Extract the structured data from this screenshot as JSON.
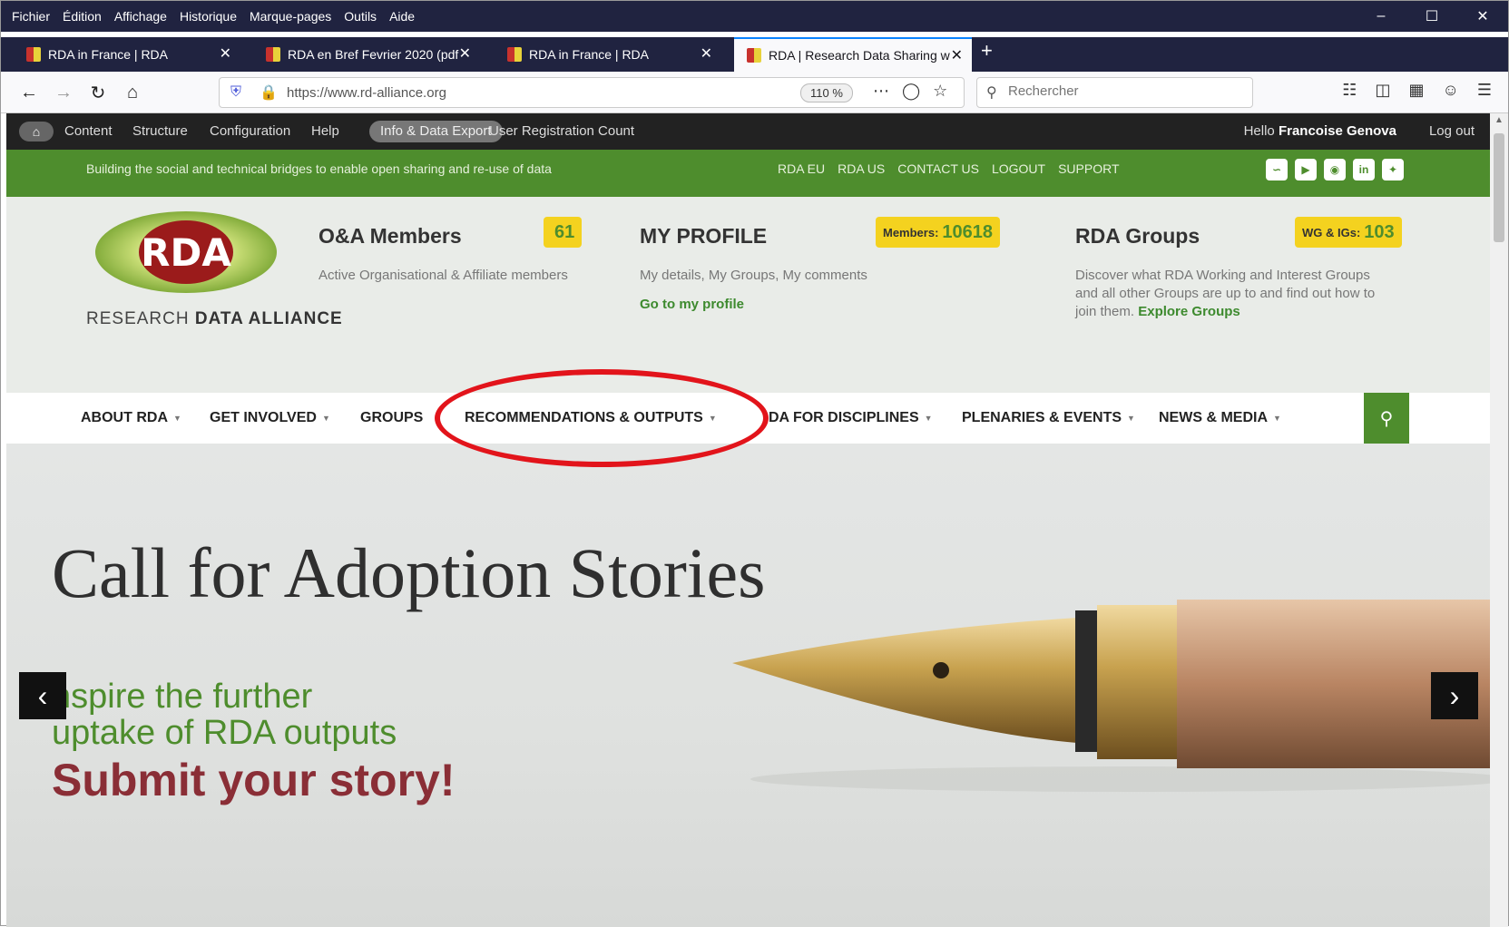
{
  "menubar": {
    "items": [
      "Fichier",
      "Édition",
      "Affichage",
      "Historique",
      "Marque-pages",
      "Outils",
      "Aide"
    ]
  },
  "window_controls": {
    "minimize": "–",
    "maximize": "☐",
    "close": "✕"
  },
  "tabs": [
    {
      "title": "RDA in France | RDA",
      "close": "✕"
    },
    {
      "title": "RDA en Bref Fevrier 2020 (pdf",
      "close": "✕"
    },
    {
      "title": "RDA in France | RDA",
      "close": "✕"
    },
    {
      "title": "RDA | Research Data Sharing w",
      "close": "✕"
    }
  ],
  "new_tab": "+",
  "navbar": {
    "url": "https://www.rd-alliance.org",
    "zoom": "110 %",
    "search_placeholder": "Rechercher"
  },
  "adminbar": {
    "items": [
      "Content",
      "Structure",
      "Configuration",
      "Help"
    ],
    "active_pill": "Info & Data Export",
    "extra": "User Registration Count",
    "hello": "Hello",
    "user": "Francoise Genova",
    "logout": "Log out"
  },
  "greenbar": {
    "tagline": "Building the social and technical bridges to enable open sharing and re-use of data",
    "links": [
      "RDA EU",
      "RDA US",
      "CONTACT US",
      "LOGOUT",
      "SUPPORT"
    ],
    "social_icons": [
      "rss-icon",
      "youtube-icon",
      "slideshare-icon",
      "linkedin-icon",
      "twitter-icon"
    ]
  },
  "logo": {
    "mark": "RDA",
    "line_a": "RESEARCH",
    "line_b": "DATA ALLIANCE"
  },
  "blocks": {
    "members": {
      "title": "O&A Members",
      "badge": "61",
      "desc": "Active Organisational & Affiliate members"
    },
    "profile": {
      "title": "MY PROFILE",
      "badge_label": "Members:",
      "badge": "10618",
      "desc": "My details, My Groups, My comments",
      "link": "Go to my profile"
    },
    "groups": {
      "title": "RDA Groups",
      "badge_label": "WG & IGs:",
      "badge": "103",
      "desc": "Discover what RDA Working and Interest Groups and all other Groups are up to and find out how to join them.",
      "link": "Explore Groups"
    }
  },
  "mainnav": {
    "items": [
      "ABOUT RDA",
      "GET INVOLVED",
      "GROUPS",
      "RECOMMENDATIONS & OUTPUTS",
      "DA FOR DISCIPLINES",
      "PLENARIES & EVENTS",
      "NEWS & MEDIA"
    ]
  },
  "hero": {
    "title": "Call for Adoption Stories",
    "line1": "nspire the further",
    "line2": "uptake of RDA outputs",
    "line3": "Submit your story!"
  },
  "colors": {
    "brand_green": "#4e8d2d",
    "badge_yellow": "#f4d21f",
    "highlight_red": "#e2141b",
    "rda_red": "#9b1b1b"
  }
}
